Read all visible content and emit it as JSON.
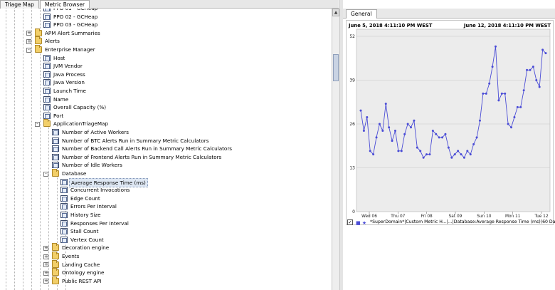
{
  "tabs": [
    {
      "label": "Triage Map",
      "active": false
    },
    {
      "label": "Metric Browser",
      "active": true
    }
  ],
  "tree_items": [
    {
      "label": "PPO 01 - GCHeap",
      "depth": 3,
      "type": "metric"
    },
    {
      "label": "PPO 02 - GCHeap",
      "depth": 3,
      "type": "metric"
    },
    {
      "label": "PPO 03 - GCHeap",
      "depth": 3,
      "type": "metric"
    },
    {
      "label": "APM Alert Summaries",
      "depth": 2,
      "type": "folder",
      "toggle": "+"
    },
    {
      "label": "Alerts",
      "depth": 2,
      "type": "folder",
      "toggle": "+"
    },
    {
      "label": "Enterprise Manager",
      "depth": 2,
      "type": "folder",
      "toggle": "-"
    },
    {
      "label": "Host",
      "depth": 3,
      "type": "metric"
    },
    {
      "label": "JVM Vendor",
      "depth": 3,
      "type": "metric"
    },
    {
      "label": "Java Process",
      "depth": 3,
      "type": "metric"
    },
    {
      "label": "Java Version",
      "depth": 3,
      "type": "metric"
    },
    {
      "label": "Launch Time",
      "depth": 3,
      "type": "metric"
    },
    {
      "label": "Name",
      "depth": 3,
      "type": "metric"
    },
    {
      "label": "Overall Capacity (%)",
      "depth": 3,
      "type": "metric"
    },
    {
      "label": "Port",
      "depth": 3,
      "type": "metric"
    },
    {
      "label": "ApplicationTriageMap",
      "depth": 3,
      "type": "folder",
      "toggle": "-"
    },
    {
      "label": "Number of Active Workers",
      "depth": 4,
      "type": "metric"
    },
    {
      "label": "Number of BTC Alerts Run in Summary Metric Calculators",
      "depth": 4,
      "type": "metric"
    },
    {
      "label": "Number of Backend Call Alerts Run in Summary Metric Calculators",
      "depth": 4,
      "type": "metric"
    },
    {
      "label": "Number of Frontend Alerts Run in Summary Metric Calculators",
      "depth": 4,
      "type": "metric"
    },
    {
      "label": "Number of Idle Workers",
      "depth": 4,
      "type": "metric"
    },
    {
      "label": "Database",
      "depth": 4,
      "type": "folder",
      "toggle": "-"
    },
    {
      "label": "Average Response Time (ms)",
      "depth": 5,
      "type": "metric",
      "selected": true
    },
    {
      "label": "Concurrent Invocations",
      "depth": 5,
      "type": "metric"
    },
    {
      "label": "Edge Count",
      "depth": 5,
      "type": "metric"
    },
    {
      "label": "Errors Per Interval",
      "depth": 5,
      "type": "metric"
    },
    {
      "label": "History Size",
      "depth": 5,
      "type": "metric"
    },
    {
      "label": "Responses Per Interval",
      "depth": 5,
      "type": "metric"
    },
    {
      "label": "Stall Count",
      "depth": 5,
      "type": "metric"
    },
    {
      "label": "Vertex Count",
      "depth": 5,
      "type": "metric"
    },
    {
      "label": "Decoration engine",
      "depth": 4,
      "type": "folder",
      "toggle": "+"
    },
    {
      "label": "Events",
      "depth": 4,
      "type": "folder",
      "toggle": "+"
    },
    {
      "label": "Landing Cache",
      "depth": 4,
      "type": "folder",
      "toggle": "+"
    },
    {
      "label": "Ontology engine",
      "depth": 4,
      "type": "folder",
      "toggle": "+"
    },
    {
      "label": "Public REST API",
      "depth": 4,
      "type": "folder",
      "toggle": "+"
    }
  ],
  "right_tab": "General",
  "chart": {
    "start_label": "June 5, 2018 4:11:10 PM WEST",
    "end_label": "June 12, 2018 4:11:10 PM WEST",
    "line_color": "#4a4cd6",
    "legend_check": "✓",
    "legend_marker": "■ ★",
    "legend": "*SuperDomain*|Custom Metric H...|...|Database:Average Response Time (ms)(60 Data Points)"
  },
  "chart_data": {
    "type": "line",
    "x_ticks": [
      "Wed 06",
      "Thu 07",
      "Fri 08",
      "Sat 09",
      "Sun 10",
      "Mon 11",
      "Tue 12"
    ],
    "y_ticks": [
      "0",
      "13",
      "26",
      "39",
      "52"
    ],
    "ylim": [
      0,
      52
    ],
    "series": [
      {
        "values": [
          30,
          24,
          28,
          18,
          17,
          22,
          26,
          24,
          32,
          25,
          21,
          24,
          18,
          18,
          23,
          26,
          25,
          27,
          19,
          18,
          16,
          17,
          17,
          24,
          23,
          22,
          22,
          23,
          19,
          16,
          17,
          18,
          17,
          16,
          18,
          17,
          20,
          22,
          27,
          35,
          35,
          38,
          43,
          49,
          33,
          35,
          35,
          26,
          25,
          28,
          31,
          31,
          36,
          42,
          42,
          43,
          39,
          37,
          48,
          47
        ]
      }
    ]
  }
}
